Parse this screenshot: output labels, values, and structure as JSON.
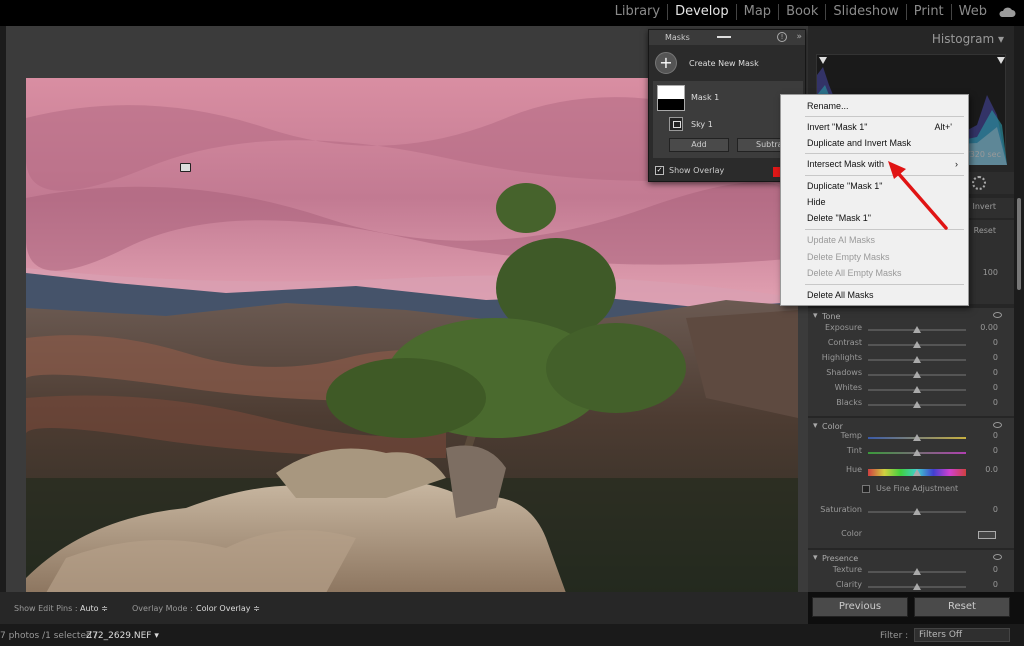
{
  "modules": [
    "Library",
    "Develop",
    "Map",
    "Book",
    "Slideshow",
    "Print",
    "Web"
  ],
  "active_module": "Develop",
  "masks_panel": {
    "title": "Masks",
    "create_label": "Create New Mask",
    "mask_name": "Mask 1",
    "component_name": "Sky 1",
    "add_label": "Add",
    "subtract_label": "Subtra",
    "show_overlay_label": "Show Overlay",
    "overlay_color": "#e01818"
  },
  "context_menu": {
    "rename": "Rename...",
    "invert": "Invert \"Mask 1\"",
    "invert_shortcut": "Alt+'",
    "duplicate_invert": "Duplicate and Invert Mask",
    "intersect": "Intersect Mask with",
    "duplicate": "Duplicate \"Mask 1\"",
    "hide": "Hide",
    "delete": "Delete \"Mask 1\"",
    "update_ai": "Update AI Masks",
    "delete_empty": "Delete Empty Masks",
    "delete_all_empty": "Delete All Empty Masks",
    "delete_all": "Delete All Masks"
  },
  "right_panel": {
    "histogram_title": "Histogram",
    "exposure_readout": "1/320 sec",
    "invert_label": "Invert",
    "reset_label": "Reset",
    "amount_value": "100",
    "tone": {
      "title": "Tone",
      "rows": [
        {
          "label": "Exposure",
          "value": "0.00",
          "pos": 0.5
        },
        {
          "label": "Contrast",
          "value": "0",
          "pos": 0.5
        },
        {
          "label": "Highlights",
          "value": "0",
          "pos": 0.5
        },
        {
          "label": "Shadows",
          "value": "0",
          "pos": 0.5
        },
        {
          "label": "Whites",
          "value": "0",
          "pos": 0.5
        },
        {
          "label": "Blacks",
          "value": "0",
          "pos": 0.5
        }
      ]
    },
    "color": {
      "title": "Color",
      "temp": {
        "label": "Temp",
        "value": "0"
      },
      "tint": {
        "label": "Tint",
        "value": "0"
      },
      "hue": {
        "label": "Hue",
        "value": "0.0"
      },
      "fine_adjust_label": "Use Fine Adjustment",
      "saturation": {
        "label": "Saturation",
        "value": "0"
      },
      "color_label": "Color"
    },
    "presence": {
      "title": "Presence",
      "texture": {
        "label": "Texture",
        "value": "0"
      },
      "clarity": {
        "label": "Clarity",
        "value": "0"
      }
    },
    "previous_label": "Previous",
    "reset_button_label": "Reset"
  },
  "toolbar": {
    "show_edit_pins_label": "Show Edit Pins :",
    "show_edit_pins_value": "Auto ≑",
    "overlay_mode_label": "Overlay Mode :",
    "overlay_mode_value": "Color Overlay ≑"
  },
  "filmstrip": {
    "count": "7 photos /1 selected /",
    "filename": "Z72_2629.NEF ▾",
    "filter_label": "Filter :",
    "filter_value": "Filters Off"
  }
}
